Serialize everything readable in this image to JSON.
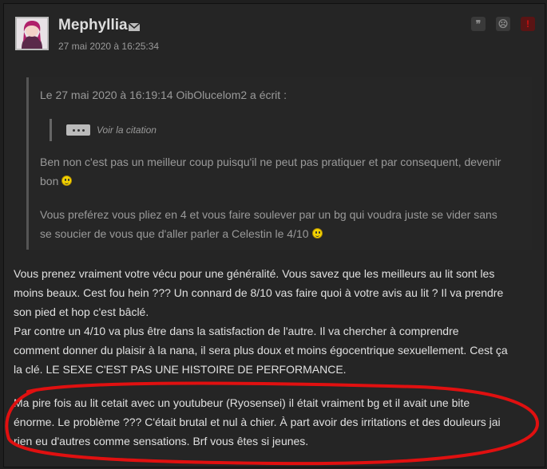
{
  "post": {
    "author": "Mephyllia",
    "date": "27 mai 2020 à 16:25:34",
    "actions": [
      {
        "name": "quote-icon",
        "glyph": "❞"
      },
      {
        "name": "neutral-face-icon",
        "glyph": "☹"
      },
      {
        "name": "report-icon",
        "glyph": "!"
      }
    ]
  },
  "quote": {
    "header": "Le 27 mai 2020 à 16:19:14 OibOlucelom2 a écrit :",
    "view_quote": "Voir la citation",
    "lines": [
      "Ben non c'est pas un meilleur coup puisqu'il ne peut pas pratiquer et par consequent, devenir",
      "bon",
      "Vous preférez vous pliez en 4 et vous faire soulever par un bg qui voudra juste se vider sans",
      "se soucier de vous que d'aller parler a Celestin le 4/10"
    ]
  },
  "body": {
    "lines": [
      "Vous prenez vraiment votre vécu pour une généralité. Vous savez que les meilleurs au lit sont les",
      "moins beaux. Cest fou hein ??? Un connard de 8/10 vas faire quoi à votre avis au lit ? Il va prendre",
      "son pied et hop c'est bâclé.",
      "Par contre un 4/10 va plus être dans la satisfaction de l'autre. Il va chercher à comprendre",
      "comment donner du plaisir à la nana, il sera plus doux et moins égocentrique sexuellement. Cest ça",
      "la clé. LE SEXE C'EST PAS UNE HISTOIRE DE PERFORMANCE.",
      "Ma pire fois au lit cetait avec un youtubeur (Ryosensei) il était vraiment bg et il avait une bite",
      "énorme. Le problème ??? C'était brutal et nul à chier. À part avoir des irritations et des douleurs jai",
      "rien eu d'autres comme sensations. Brf vous êtes si jeunes."
    ]
  },
  "colors": {
    "annotation": "#e01010",
    "smiley": "#f2d200"
  }
}
